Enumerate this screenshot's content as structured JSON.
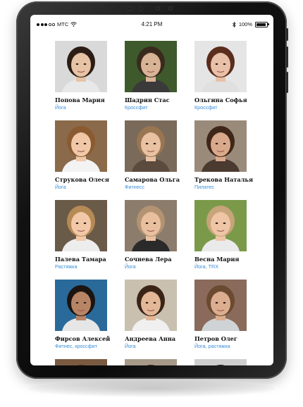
{
  "status_bar": {
    "carrier": "MTC",
    "time": "4:21 PM",
    "battery": "100%",
    "signal_icon": "signal-dots-icon",
    "wifi_icon": "wifi-icon",
    "bluetooth_icon": "bluetooth-icon",
    "battery_icon": "battery-icon"
  },
  "trainers": [
    {
      "name": "Попова Мария",
      "specialty": "Йога",
      "hair": "#2b1c14",
      "skin": "#e6c3a5",
      "bg": "#d9d9d9",
      "shirt": "#e8e8e8"
    },
    {
      "name": "Шадрин Стас",
      "specialty": "Кроссфит",
      "hair": "#3a2a1e",
      "skin": "#d9b396",
      "bg": "#3e5a2c",
      "shirt": "#3a3a3a"
    },
    {
      "name": "Ольгина Софья",
      "specialty": "Кроссфит",
      "hair": "#5a2d1c",
      "skin": "#e8c1a8",
      "bg": "#e5e5e5",
      "shirt": "#e0e0e0"
    },
    {
      "name": "Струкова Олеся",
      "specialty": "Йога",
      "hair": "#8a5a30",
      "skin": "#f0c8a8",
      "bg": "#8a6a4a",
      "shirt": "#f3f3f3"
    },
    {
      "name": "Самарова Ольга",
      "specialty": "Фитнесс",
      "hair": "#9a7552",
      "skin": "#e8c2a2",
      "bg": "#7a6a5a",
      "shirt": "#5b4a3e"
    },
    {
      "name": "Трекова Наталья",
      "specialty": "Пилатес",
      "hair": "#3e2618",
      "skin": "#d8a98a",
      "bg": "#9a8a7a",
      "shirt": "#4a3a30"
    },
    {
      "name": "Палева Тамара",
      "specialty": "Растяжка",
      "hair": "#b58a55",
      "skin": "#f2c9a8",
      "bg": "#6a5a48",
      "shirt": "#ededed"
    },
    {
      "name": "Сочнева Лера",
      "specialty": "Йога",
      "hair": "#b39372",
      "skin": "#e8c0a0",
      "bg": "#8c7c6c",
      "shirt": "#2a2a2a"
    },
    {
      "name": "Весна Мария",
      "specialty": "Йога, TRX",
      "hair": "#c8a47a",
      "skin": "#eec6a6",
      "bg": "#7a9a4a",
      "shirt": "#eaeaea"
    },
    {
      "name": "Фирсов Алексей",
      "specialty": "Фитнес, кроссфит",
      "hair": "#1b1410",
      "skin": "#b88466",
      "bg": "#2a6a9a",
      "shirt": "#e6e6e6"
    },
    {
      "name": "Андреева Анна",
      "specialty": "Йога",
      "hair": "#3a2416",
      "skin": "#e2b898",
      "bg": "#c9c0b0",
      "shirt": "#f0f0f0"
    },
    {
      "name": "Петров Олег",
      "specialty": "Йога, растяжка",
      "hair": "#6a4a30",
      "skin": "#dcae90",
      "bg": "#8a6a5a",
      "shirt": "#cfd3d6"
    },
    {
      "name": "",
      "specialty": "",
      "hair": "#5a3a22",
      "skin": "#d8b092",
      "bg": "#7a5a40",
      "shirt": "#cfcfcf"
    },
    {
      "name": "",
      "specialty": "",
      "hair": "#4a2e1e",
      "skin": "#d8b092",
      "bg": "#a89a88",
      "shirt": "#cfcfcf"
    },
    {
      "name": "",
      "specialty": "",
      "hair": "#2e2218",
      "skin": "#d8b092",
      "bg": "#cfcfcf",
      "shirt": "#cfcfcf"
    }
  ]
}
